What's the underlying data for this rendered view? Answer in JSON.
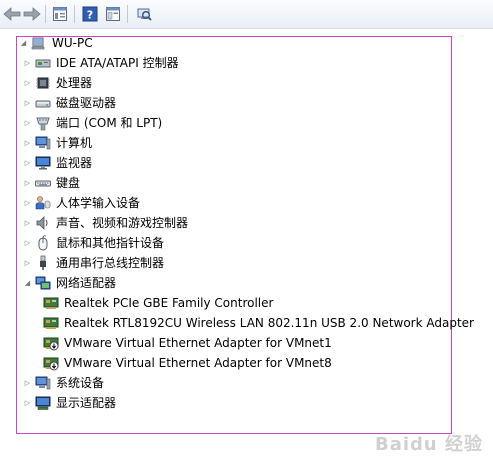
{
  "toolbar": {
    "buttons": [
      "back-icon",
      "forward-icon",
      "properties-icon",
      "help-icon",
      "show-hide-icon",
      "scan-hardware-icon"
    ]
  },
  "tree": {
    "root": "WU-PC",
    "categories": [
      {
        "label": "IDE ATA/ATAPI 控制器"
      },
      {
        "label": "处理器"
      },
      {
        "label": "磁盘驱动器"
      },
      {
        "label": "端口 (COM 和 LPT)"
      },
      {
        "label": "计算机"
      },
      {
        "label": "监视器"
      },
      {
        "label": "键盘"
      },
      {
        "label": "人体学输入设备"
      },
      {
        "label": "声音、视频和游戏控制器"
      },
      {
        "label": "鼠标和其他指针设备"
      },
      {
        "label": "通用串行总线控制器"
      },
      {
        "label": "网络适配器"
      },
      {
        "label": "系统设备"
      },
      {
        "label": "显示适配器"
      }
    ],
    "network_children": [
      {
        "label": "Realtek PCIe GBE Family Controller"
      },
      {
        "label": "Realtek RTL8192CU Wireless LAN 802.11n USB 2.0 Network Adapter"
      },
      {
        "label": "VMware Virtual Ethernet Adapter for VMnet1"
      },
      {
        "label": "VMware Virtual Ethernet Adapter for VMnet8"
      }
    ]
  },
  "watermark": "Baidu 经验"
}
